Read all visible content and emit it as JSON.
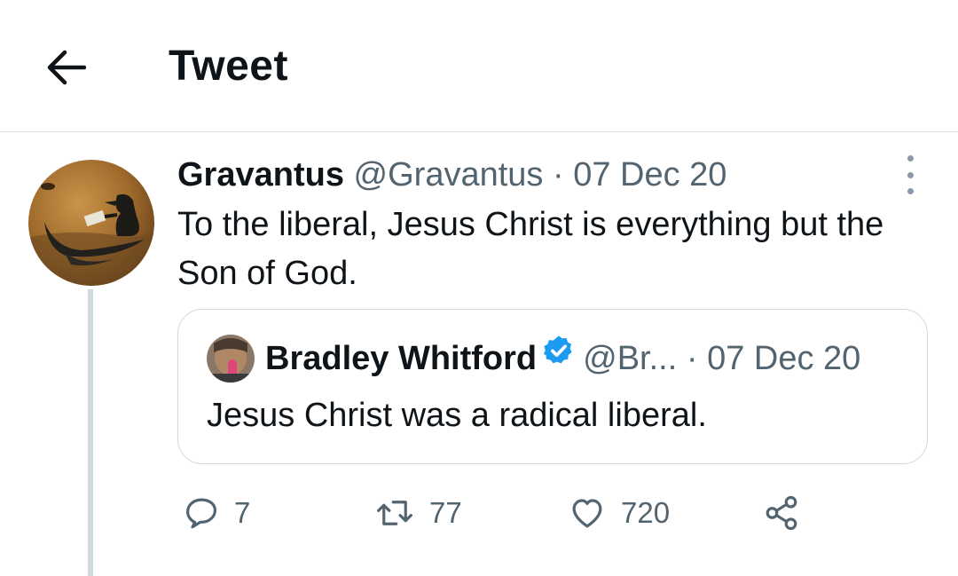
{
  "header": {
    "title": "Tweet",
    "back_icon": "arrow-left-icon"
  },
  "tweet": {
    "author_name": "Gravantus",
    "author_handle": "@Gravantus",
    "separator": "·",
    "date": "07 Dec 20",
    "text": "To the liberal, Jesus Christ is everything but the Son of God."
  },
  "quoted_tweet": {
    "author_name": "Bradley Whitford",
    "verified": true,
    "author_handle": "@Br...",
    "separator": "·",
    "date": "07 Dec 20",
    "text": "Jesus Christ was a radical liberal."
  },
  "actions": {
    "reply_count": "7",
    "retweet_count": "77",
    "like_count": "720"
  },
  "colors": {
    "muted": "#536471",
    "verified": "#1d9bf0",
    "thread_line": "#cfd9de"
  }
}
